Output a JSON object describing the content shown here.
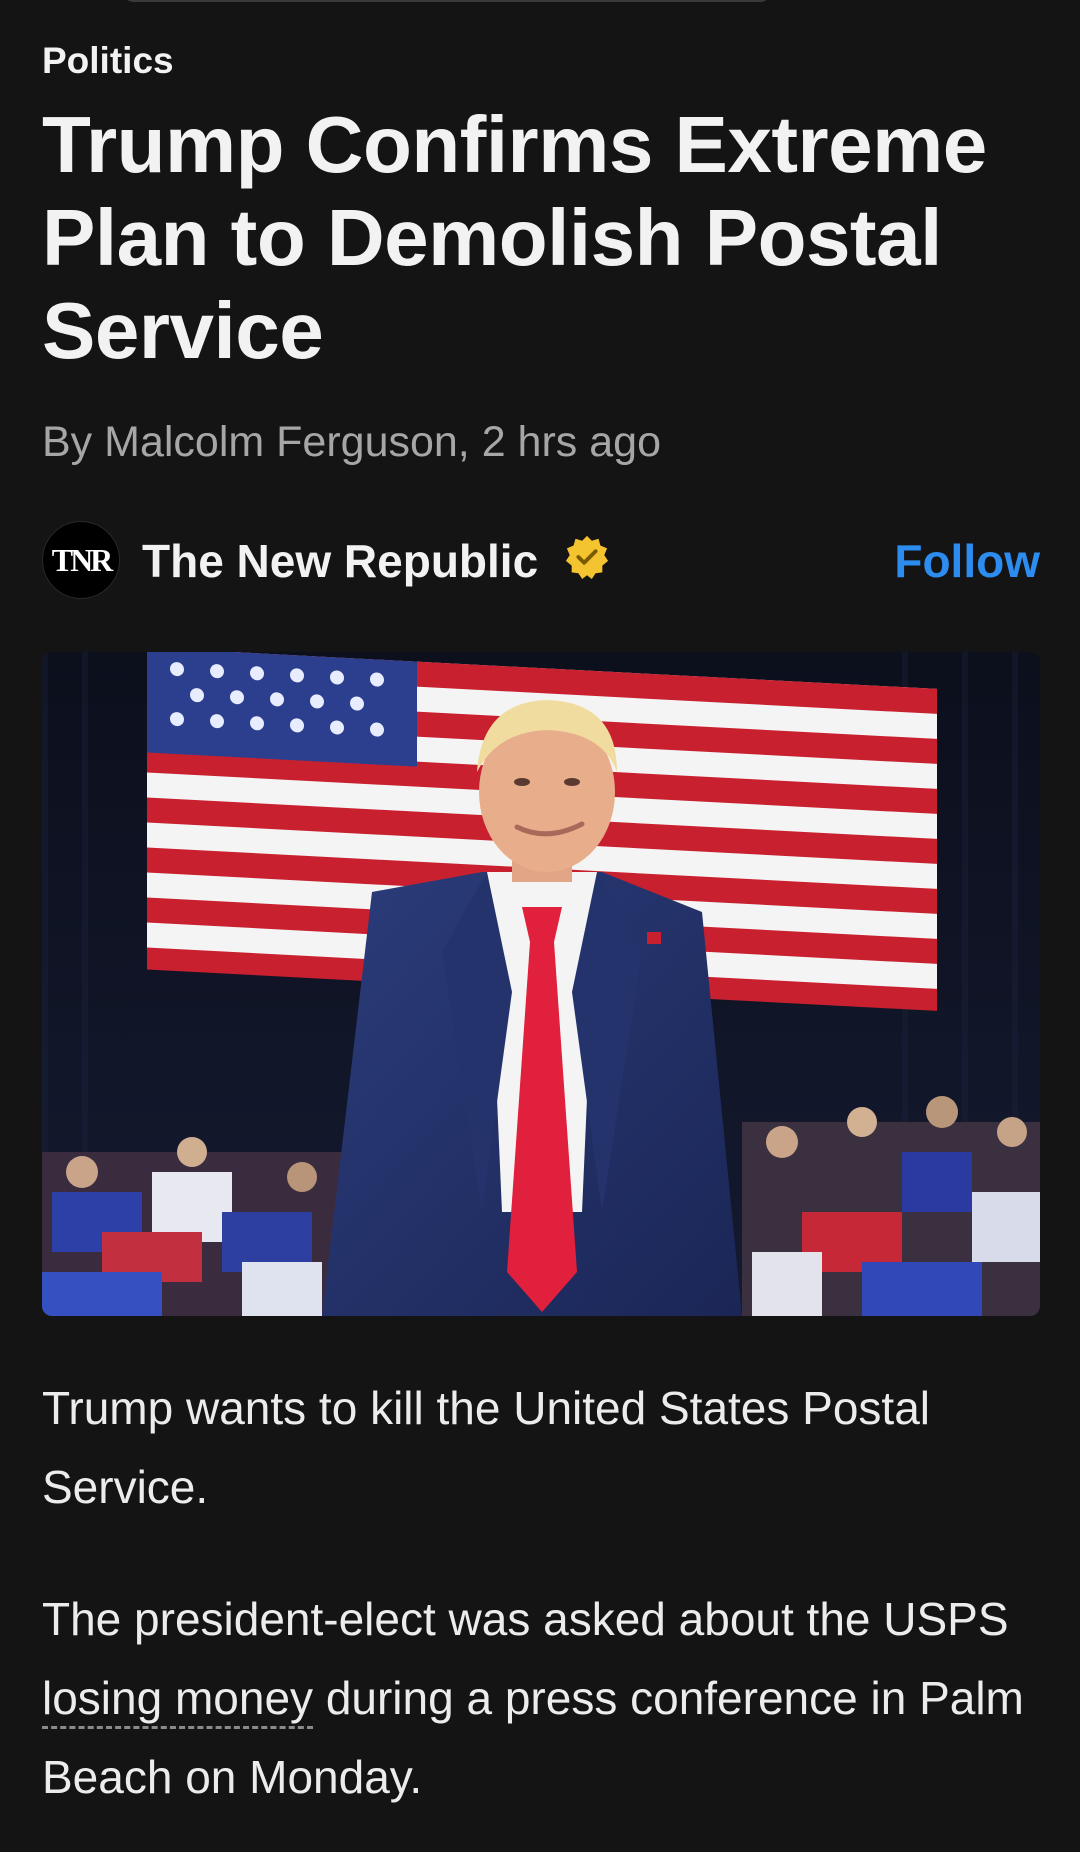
{
  "article": {
    "category": "Politics",
    "headline": "Trump Confirms Extreme Plan to Demolish Postal Service",
    "byline": "By Malcolm Ferguson, 2 hrs ago"
  },
  "publisher": {
    "avatar_text": "TNR",
    "name": "The New Republic",
    "verified_icon": "verified-badge-icon",
    "follow_label": "Follow"
  },
  "body": {
    "p1": "Trump wants to kill the United States Postal Service.",
    "p2_before": "The president-elect was asked about the USPS ",
    "p2_link": "losing money",
    "p2_after": " during a press conference in Palm Beach on Monday."
  },
  "colors": {
    "background": "#141414",
    "accent": "#2d8cf0",
    "verified": "#f4c430",
    "byline": "#a6a6a6"
  }
}
